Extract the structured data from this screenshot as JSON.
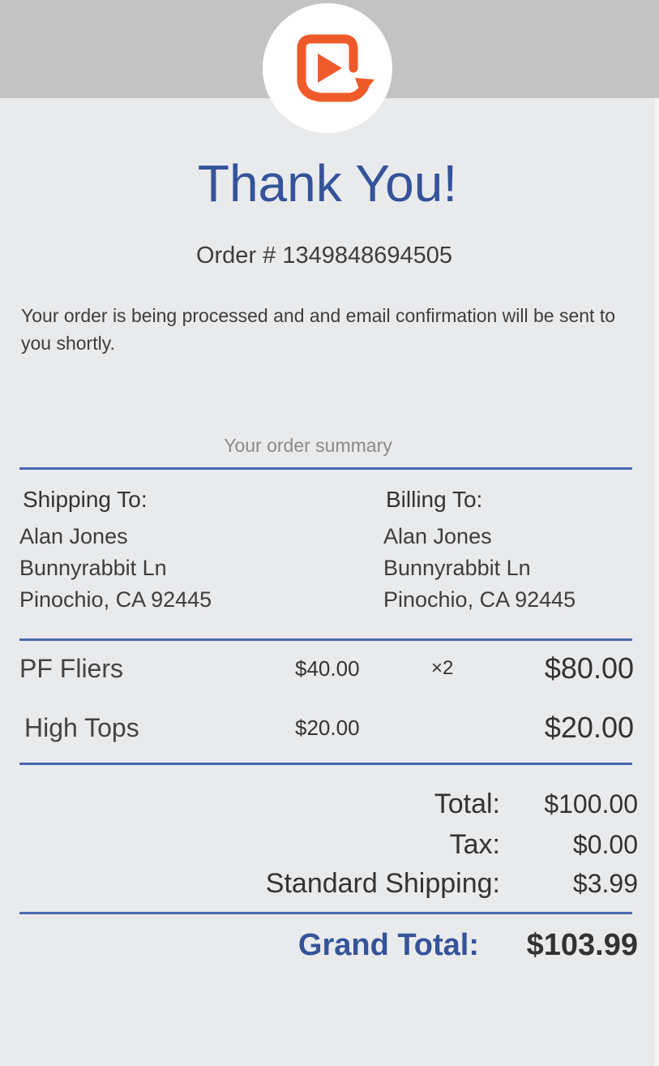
{
  "header": {
    "logo_icon": "replay-video-icon"
  },
  "title": "Thank You!",
  "order_number": "Order # 1349848694505",
  "message": "Your order is being processed and and email confirmation will be sent to you shortly.",
  "summary": {
    "heading": "Your order summary",
    "shipping": {
      "label": "Shipping To:",
      "name": "Alan Jones",
      "street": "Bunnyrabbit Ln",
      "city": "Pinochio, CA 92445"
    },
    "billing": {
      "label": "Billing To:",
      "name": "Alan Jones",
      "street": "Bunnyrabbit Ln",
      "city": "Pinochio, CA 92445"
    },
    "items": [
      {
        "name": "PF Fliers",
        "price": "$40.00",
        "qty": "×2",
        "amount": "$80.00"
      },
      {
        "name": "High Tops",
        "price": "$20.00",
        "qty": "",
        "amount": "$20.00"
      }
    ],
    "totals": {
      "total_label": "Total:",
      "total_value": "$100.00",
      "tax_label": "Tax:",
      "tax_value": "$0.00",
      "shipping_label": "Standard Shipping:",
      "shipping_value": "$3.99"
    },
    "grand_total": {
      "label": "Grand Total:",
      "value": "$103.99"
    }
  },
  "colors": {
    "accent": "#34539a",
    "logo": "#ef5a2a",
    "rule": "#4a68b0"
  }
}
